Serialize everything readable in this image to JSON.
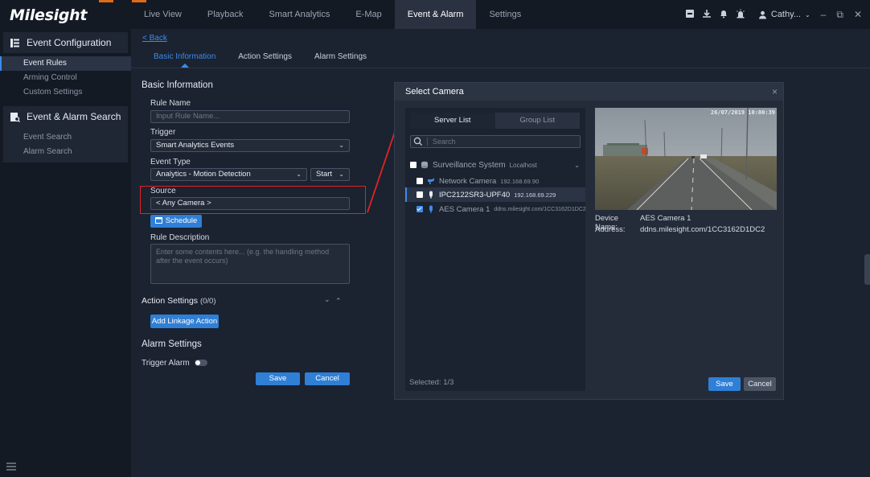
{
  "app": {
    "logo": "Milesight"
  },
  "nav": {
    "items": [
      "Live View",
      "Playback",
      "Smart Analytics",
      "E-Map",
      "Event & Alarm",
      "Settings"
    ],
    "active": "Event & Alarm"
  },
  "user": {
    "name": "Cathy..."
  },
  "sidebar": {
    "group1": {
      "title": "Event Configuration",
      "items": [
        "Event Rules",
        "Arming Control",
        "Custom Settings"
      ],
      "active": "Event Rules"
    },
    "group2": {
      "title": "Event & Alarm Search",
      "items": [
        "Event Search",
        "Alarm Search"
      ]
    }
  },
  "form": {
    "back": "Back",
    "tabs": [
      "Basic Information",
      "Action Settings",
      "Alarm Settings"
    ],
    "active_tab": "Basic Information",
    "basic_title": "Basic Information",
    "rule_name_label": "Rule Name",
    "rule_name_placeholder": "Input Rule Name...",
    "trigger_label": "Trigger",
    "trigger_value": "Smart Analytics Events",
    "event_type_label": "Event Type",
    "event_type_value": "Analytics - Motion Detection",
    "event_state_value": "Start",
    "source_label": "Source",
    "source_value": "< Any Camera >",
    "schedule_button": "Schedule",
    "desc_label": "Rule Description",
    "desc_placeholder": "Enter some contents here... (e.g. the handling method after the event occurs)",
    "action_title": "Action Settings",
    "action_count": "(0/0)",
    "add_linkage_button": "Add Linkage Action",
    "alarm_title": "Alarm Settings",
    "trigger_alarm_label": "Trigger Alarm",
    "save_button": "Save",
    "cancel_button": "Cancel"
  },
  "modal": {
    "title": "Select Camera",
    "seg": [
      "Server List",
      "Group List"
    ],
    "search_placeholder": "Search",
    "tree": [
      {
        "name": "Surveillance System",
        "sub": "Localhost",
        "checked": false
      },
      {
        "name": "Network Camera",
        "sub": "192.168.69.90",
        "checked": false
      },
      {
        "name": "IPC2122SR3-UPF40",
        "sub": "192.168.69.229",
        "checked": false
      },
      {
        "name": "AES Camera 1",
        "sub": "ddns.milesight.com/1CC3162D1DC2",
        "checked": true
      }
    ],
    "selected": "Selected: 1/3",
    "preview_timestamp": "26/07/2019 10:00:39",
    "device_name_key": "Device Name:",
    "device_name_val": "AES Camera 1",
    "address_key": "Address:",
    "address_val": "ddns.milesight.com/1CC3162D1DC2",
    "save_button": "Save",
    "cancel_button": "Cancel"
  },
  "colors": {
    "accent": "#3d8bea",
    "brand_orange": "#e06a18",
    "annotation_red": "#e02424"
  }
}
